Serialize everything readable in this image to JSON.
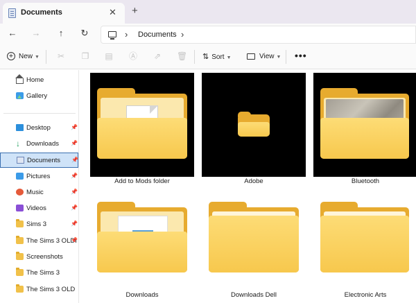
{
  "tab": {
    "title": "Documents",
    "close": "✕",
    "new_tab": "+"
  },
  "nav": {
    "back": "←",
    "forward": "→",
    "up": "↑",
    "refresh": "↻"
  },
  "address": {
    "crumbs": [
      "Documents"
    ],
    "chevron": "›"
  },
  "commands": {
    "new_label": "New",
    "sort_label": "Sort",
    "view_label": "View",
    "more": "•••",
    "icons": [
      "cut-icon",
      "copy-icon",
      "paste-icon",
      "rename-icon",
      "share-icon",
      "delete-icon"
    ]
  },
  "sidebar": {
    "top": [
      {
        "label": "Home",
        "icon": "home-icon"
      },
      {
        "label": "Gallery",
        "icon": "gallery-icon"
      }
    ],
    "pinned": [
      {
        "label": "Desktop",
        "icon": "desktop-icon",
        "pinned": true
      },
      {
        "label": "Downloads",
        "icon": "download-icon",
        "pinned": true
      },
      {
        "label": "Documents",
        "icon": "documents-icon",
        "pinned": true,
        "selected": true
      },
      {
        "label": "Pictures",
        "icon": "pictures-icon",
        "pinned": true
      },
      {
        "label": "Music",
        "icon": "music-icon",
        "pinned": true
      },
      {
        "label": "Videos",
        "icon": "videos-icon",
        "pinned": true
      },
      {
        "label": "Sims 3",
        "icon": "folder-icon",
        "pinned": true
      },
      {
        "label": "The Sims 3 OLDI",
        "icon": "folder-icon",
        "pinned": true
      },
      {
        "label": "Screenshots",
        "icon": "folder-icon",
        "pinned": false
      },
      {
        "label": "The Sims 3",
        "icon": "folder-icon",
        "pinned": false
      },
      {
        "label": "The Sims 3 OLD",
        "icon": "folder-icon",
        "pinned": false
      }
    ],
    "pin_glyph": "📌"
  },
  "items": [
    {
      "name": "Add to Mods folder",
      "thumb": "folder-with-document"
    },
    {
      "name": "Adobe",
      "thumb": "small-folder"
    },
    {
      "name": "Bluetooth",
      "thumb": "folder-with-photo"
    },
    {
      "name": "Downloads",
      "thumb": "folder-with-image"
    },
    {
      "name": "Downloads Dell",
      "thumb": "folder"
    },
    {
      "name": "Electronic Arts",
      "thumb": "folder"
    }
  ],
  "colors": {
    "accent": "#3b6fb0",
    "selected_bg": "#cfe3f8",
    "folder": "#f7c84d"
  }
}
